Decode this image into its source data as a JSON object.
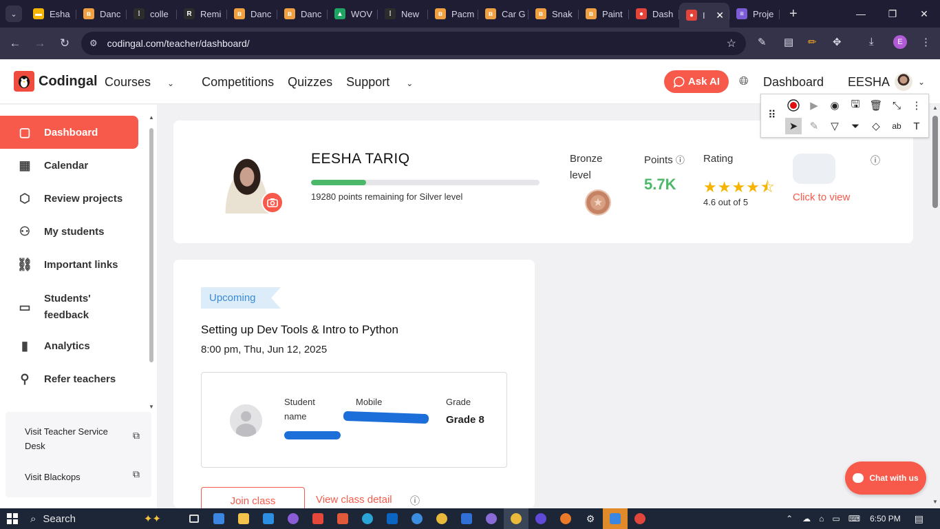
{
  "browser": {
    "tabs": [
      {
        "label": "Esha",
        "color": "#f4b400",
        "glyph": "▬"
      },
      {
        "label": "Danc",
        "color": "#f0a040",
        "glyph": "ʙ"
      },
      {
        "label": "colle",
        "color": "#2c2c2c",
        "glyph": "⁞"
      },
      {
        "label": "Remi",
        "color": "#2c2c2c",
        "glyph": "R"
      },
      {
        "label": "Danc",
        "color": "#f0a040",
        "glyph": "ʙ"
      },
      {
        "label": "Danc",
        "color": "#f0a040",
        "glyph": "ʙ"
      },
      {
        "label": "WOV",
        "color": "#1fa463",
        "glyph": "▲"
      },
      {
        "label": "New",
        "color": "#2c2c2c",
        "glyph": "⁞"
      },
      {
        "label": "Pacm",
        "color": "#f0a040",
        "glyph": "ʙ"
      },
      {
        "label": "Car G",
        "color": "#f0a040",
        "glyph": "ʙ"
      },
      {
        "label": "Snak",
        "color": "#f0a040",
        "glyph": "ʙ"
      },
      {
        "label": "Paint",
        "color": "#f0a040",
        "glyph": "ʙ"
      },
      {
        "label": "Dash",
        "color": "#e2443a",
        "glyph": "●"
      },
      {
        "label": "I",
        "color": "#e2443a",
        "glyph": "●"
      },
      {
        "label": "Proje",
        "color": "#7b5bd6",
        "glyph": "≡"
      }
    ],
    "active_tab_index": 13,
    "url": "codingal.com/teacher/dashboard/",
    "profile_initial": "E"
  },
  "header": {
    "logo_text": "Codingal",
    "nav": [
      "Courses",
      "Competitions",
      "Quizzes",
      "Support"
    ],
    "ask_ai": "Ask AI",
    "dashboard": "Dashboard",
    "user": "EESHA",
    "brand_color": "#f75a4a"
  },
  "sidebar": {
    "items": [
      {
        "label": "Dashboard",
        "icon": "clipboard-icon",
        "glyph": "▢"
      },
      {
        "label": "Calendar",
        "icon": "calendar-icon",
        "glyph": "▦"
      },
      {
        "label": "Review projects",
        "icon": "cube-icon",
        "glyph": "⬡"
      },
      {
        "label": "My students",
        "icon": "users-icon",
        "glyph": "⚇"
      },
      {
        "label": "Important links",
        "icon": "link-icon",
        "glyph": "⛓"
      },
      {
        "label": "Students' feedback",
        "icon": "message-icon",
        "glyph": "▭"
      },
      {
        "label": "Analytics",
        "icon": "bar-chart-icon",
        "glyph": "▮"
      },
      {
        "label": "Refer teachers",
        "icon": "add-user-icon",
        "glyph": "⚲"
      }
    ],
    "links": [
      "Visit Teacher Service Desk",
      "Visit Blackops"
    ]
  },
  "profile": {
    "name": "EESHA TARIQ",
    "progress_fraction": 0.24,
    "remaining": "19280 points remaining for Silver level",
    "level_label": "Bronze level",
    "points_label": "Points",
    "points": "5.7K",
    "rating_label": "Rating",
    "stars": "★★★★⯪",
    "rating_value": 4.6,
    "rating_text": "4.6 out of 5",
    "click_to_view": "Click to view"
  },
  "upcoming_class": {
    "badge": "Upcoming",
    "title": "Setting up Dev Tools & Intro to Python",
    "time": "8:00 pm, Thu, Jun 12, 2025",
    "student_label": "Student name",
    "mobile_label": "Mobile",
    "grade_label": "Grade",
    "grade_value": "Grade 8",
    "join": "Join class",
    "view_detail": "View class detail"
  },
  "chat": {
    "label": "Chat with us"
  },
  "taskbar": {
    "search": "Search",
    "time": "6:50 PM"
  }
}
